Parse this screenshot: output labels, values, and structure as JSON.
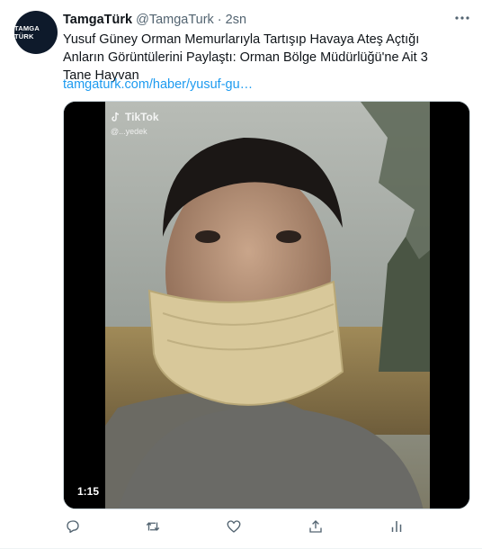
{
  "tweet": {
    "avatar_text": "TAMGA TÜRK",
    "display_name": "TamgaTürk",
    "handle": "@TamgaTurk",
    "separator": "·",
    "time": "2sn",
    "text": "Yusuf Güney Orman Memurlarıyla Tartışıp Havaya Ateş Açtığı Anların Görüntülerini Paylaştı: Orman Bölge Müdürlüğü'ne Ait 3 Tane Hayvan",
    "link": "tamgaturk.com/haber/yusuf-gu…",
    "media": {
      "duration": "1:15",
      "watermark": "TikTok",
      "watermark_user": "@...yedek"
    }
  },
  "icons": {
    "more": "more-icon",
    "reply": "reply-icon",
    "retweet": "retweet-icon",
    "like": "like-icon",
    "share": "share-icon",
    "analytics": "analytics-icon"
  },
  "colors": {
    "link": "#1d9bf0",
    "icon": "#536471",
    "text": "#0f1419"
  }
}
